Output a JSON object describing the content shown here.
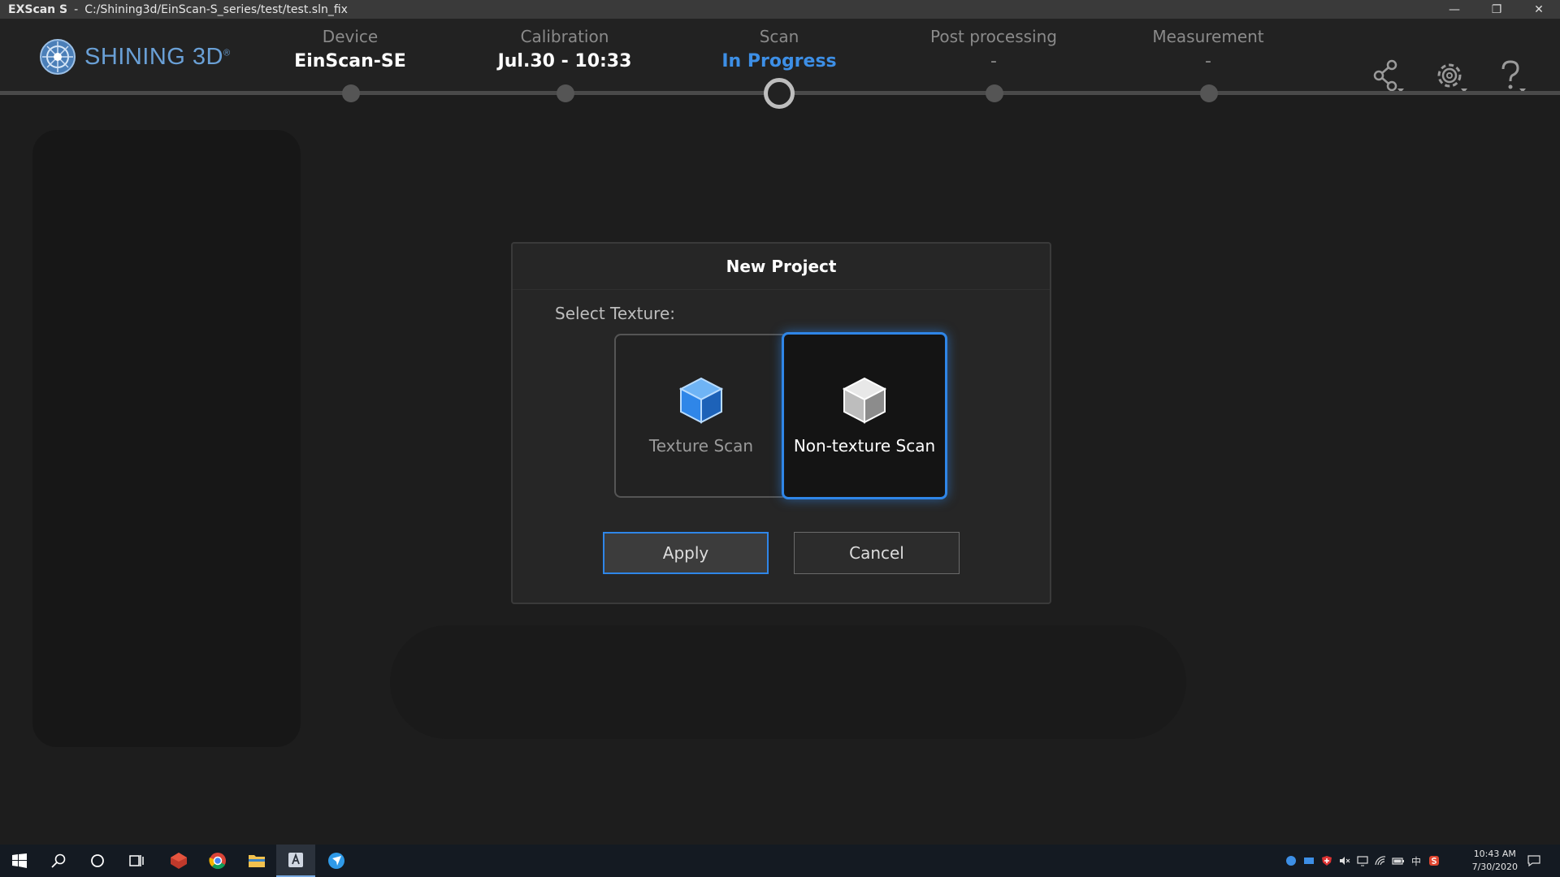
{
  "titlebar": {
    "app_name": "EXScan S",
    "separator": "-",
    "path": "C:/Shining3d/EinScan-S_series/test/test.sln_fix",
    "minimize": "—",
    "restore": "❐",
    "close": "✕"
  },
  "logo": {
    "text": "SHINING 3D",
    "registered": "®"
  },
  "steps": [
    {
      "label": "Device",
      "value": "EinScan-SE"
    },
    {
      "label": "Calibration",
      "value": "Jul.30 - 10:33"
    },
    {
      "label": "Scan",
      "value": "In Progress"
    },
    {
      "label": "Post processing",
      "value": "-"
    },
    {
      "label": "Measurement",
      "value": "-"
    }
  ],
  "header_icons": [
    "share-icon",
    "settings-icon",
    "help-icon"
  ],
  "dialog": {
    "title": "New Project",
    "select_label": "Select Texture:",
    "options": [
      {
        "label": "Texture Scan",
        "icon": "cube-blue-icon",
        "selected": false
      },
      {
        "label": "Non-texture Scan",
        "icon": "cube-gray-icon",
        "selected": true
      }
    ],
    "apply_label": "Apply",
    "cancel_label": "Cancel"
  },
  "taskbar": {
    "icons": [
      "windows-start-icon",
      "search-icon",
      "cortana-icon",
      "task-view-icon",
      "app-red-icon",
      "chrome-icon",
      "file-explorer-icon",
      "exscan-icon",
      "blue-app-icon"
    ],
    "active_icon": "exscan-icon",
    "tray_icons": [
      "tray-app-icon",
      "tray-network-icon",
      "tray-shield-icon",
      "volume-muted-icon",
      "display-icon",
      "wifi-icon",
      "battery-icon",
      "ime-icon",
      "tray-s-icon"
    ],
    "ime_label": "中",
    "time": "10:43 AM",
    "date": "7/30/2020"
  },
  "colors": {
    "accent": "#2f86e8",
    "active_step": "#3d8fe6",
    "background": "#1d1d1d"
  }
}
